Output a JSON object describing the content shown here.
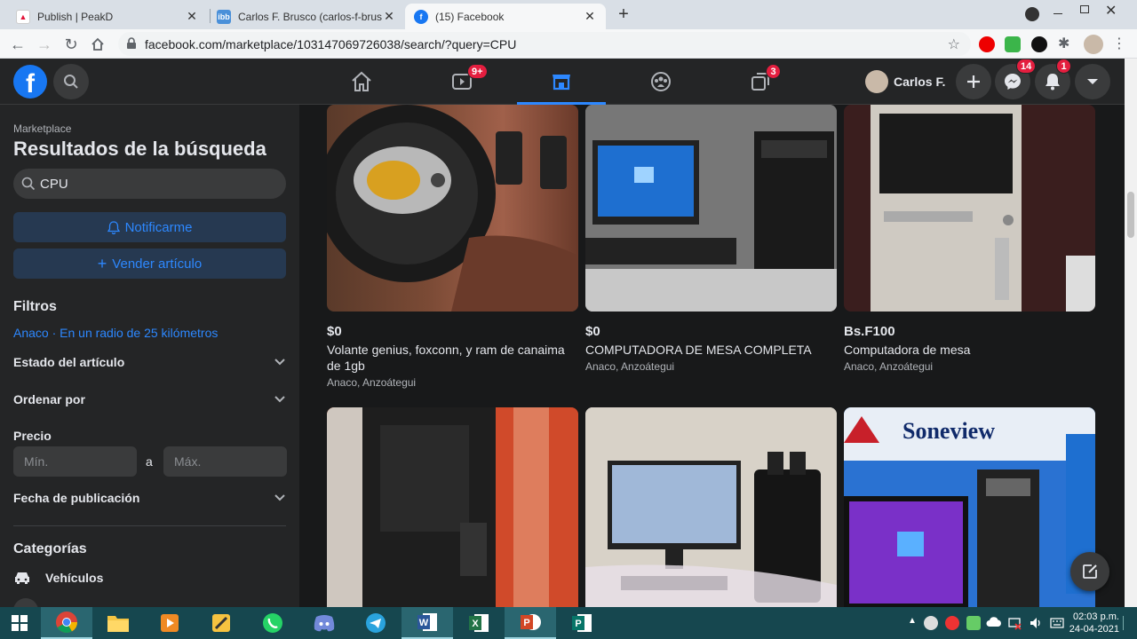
{
  "browser": {
    "tabs": [
      {
        "title": "Publish | PeakD",
        "close": "✕"
      },
      {
        "title": "Carlos F. Brusco (carlos-f-brusco)",
        "close": "✕"
      },
      {
        "title": "(15) Facebook",
        "close": "✕"
      }
    ],
    "new_tab": "+",
    "url": "facebook.com/marketplace/103147069726038/search/?query=CPU"
  },
  "fb": {
    "nav_badges": {
      "watch": "9+",
      "gaming": "3"
    },
    "profile_name": "Carlos F.",
    "messenger_badge": "14",
    "notifications_badge": "1"
  },
  "sidebar": {
    "section": "Marketplace",
    "title": "Resultados de la búsqueda",
    "search_value": "CPU",
    "notify_button": "Notificarme",
    "sell_button": "Vender artículo",
    "filters_heading": "Filtros",
    "location_link": "Anaco · En un radio de 25 kilómetros",
    "item_state": "Estado del artículo",
    "sort_by": "Ordenar por",
    "price_heading": "Precio",
    "min_placeholder": "Mín.",
    "range_sep": "a",
    "max_placeholder": "Máx.",
    "date_posted": "Fecha de publicación",
    "categories_heading": "Categorías",
    "category_vehicles": "Vehículos"
  },
  "listings": [
    {
      "price": "$0",
      "title": "Volante genius, foxconn, y ram de canaima de 1gb",
      "location": "Anaco, Anzoátegui",
      "image": "steering-wheel"
    },
    {
      "price": "$0",
      "title": "COMPUTADORA DE MESA COMPLETA",
      "location": "Anaco, Anzoátegui",
      "image": "desktop-pc"
    },
    {
      "price": "Bs.F100",
      "title": "Computadora de mesa",
      "location": "Anaco, Anzoátegui",
      "image": "pc-tower"
    },
    {
      "price": "",
      "title": "",
      "location": "",
      "image": "pc-case-closeup"
    },
    {
      "price": "",
      "title": "",
      "location": "",
      "image": "desktop-with-speakers"
    },
    {
      "price": "",
      "title": "",
      "location": "",
      "image": "soneview-ad",
      "brand_text": "Soneview"
    }
  ],
  "taskbar": {
    "time": "02:03 p.m.",
    "date": "24-04-2021"
  }
}
